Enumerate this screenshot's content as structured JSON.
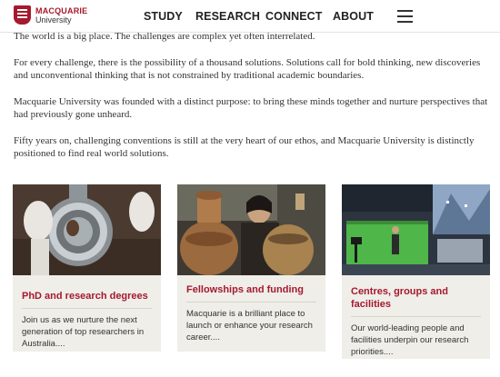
{
  "brand": {
    "name": "MACQUARIE",
    "sub": "University",
    "color": "#a6192e"
  },
  "nav": {
    "study": "STUDY",
    "research": "RESEARCH",
    "connect": "CONNECT",
    "about": "ABOUT"
  },
  "menu_icon": "hamburger-menu-icon",
  "intro": [
    "The world is a big place. The challenges are complex yet often interrelated.",
    "For every challenge, there is the possibility of a thousand solutions. Solutions call for bold thinking, new discoveries and unconventional thinking that is not constrained by traditional academic boundaries.",
    "Macquarie University was founded with a distinct purpose: to bring these minds together and nurture perspectives that had previously gone unheard.",
    "Fifty years on, challenging conventions is still at the very heart of our ethos, and Macquarie University is distinctly positioned to find real world solutions."
  ],
  "cards": [
    {
      "title": "PhD and research degrees",
      "desc": "Join us as we nurture the next generation of top researchers in Australia...."
    },
    {
      "title": "Fellowships and funding",
      "desc": "Macquarie is a brilliant place to launch or enhance your research career...."
    },
    {
      "title": "Centres, groups and facilities",
      "desc": "Our world-leading people and facilities underpin our research priorities...."
    }
  ]
}
